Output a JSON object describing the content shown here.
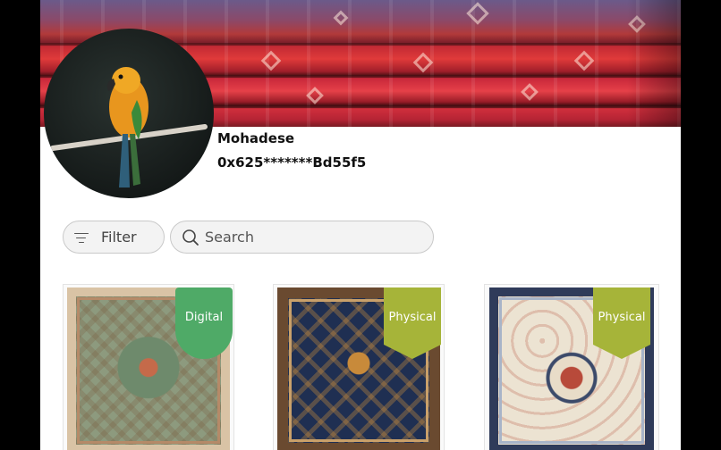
{
  "profile": {
    "name": "Mohadese",
    "address": "0x625*******Bd55f5",
    "avatar_subject": "parrot-photo",
    "banner_subject": "stacked-red-rugs-photo"
  },
  "toolbar": {
    "filter_label": "Filter",
    "filter_icon": "filter-lines-icon",
    "search_placeholder": "Search",
    "search_icon": "search-icon"
  },
  "products": [
    {
      "tag": "Digital",
      "tag_color": "#4faa67",
      "rug_style": "beige-green-oriental-rug"
    },
    {
      "tag": "Physical",
      "tag_color": "#a6b439",
      "rug_style": "navy-tribal-rug"
    },
    {
      "tag": "Physical",
      "tag_color": "#a6b439",
      "rug_style": "cream-floral-persian-rug"
    }
  ]
}
